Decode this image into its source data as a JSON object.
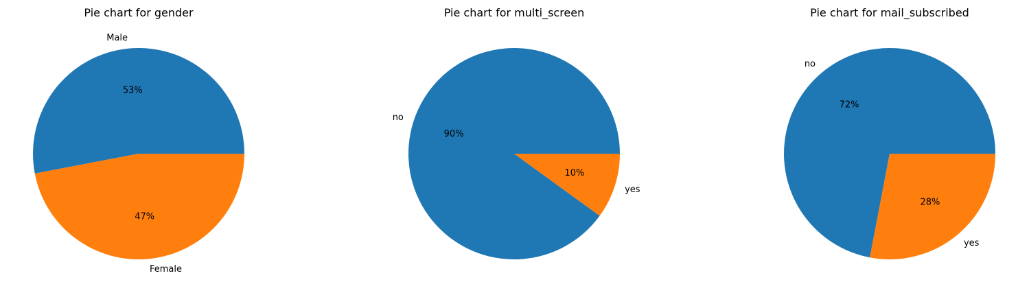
{
  "chart_data": [
    {
      "type": "pie",
      "title": "Pie chart for gender",
      "labels": [
        "Male",
        "Female"
      ],
      "values": [
        53,
        47
      ],
      "pct_labels": [
        "53%",
        "47%"
      ],
      "colors": [
        "#1f77b4",
        "#ff7f0e"
      ]
    },
    {
      "type": "pie",
      "title": "Pie chart for multi_screen",
      "labels": [
        "no",
        "yes"
      ],
      "values": [
        90,
        10
      ],
      "pct_labels": [
        "90%",
        "10%"
      ],
      "colors": [
        "#1f77b4",
        "#ff7f0e"
      ]
    },
    {
      "type": "pie",
      "title": "Pie chart for mail_subscribed",
      "labels": [
        "no",
        "yes"
      ],
      "values": [
        72,
        28
      ],
      "pct_labels": [
        "72%",
        "28%"
      ],
      "colors": [
        "#1f77b4",
        "#ff7f0e"
      ]
    }
  ]
}
